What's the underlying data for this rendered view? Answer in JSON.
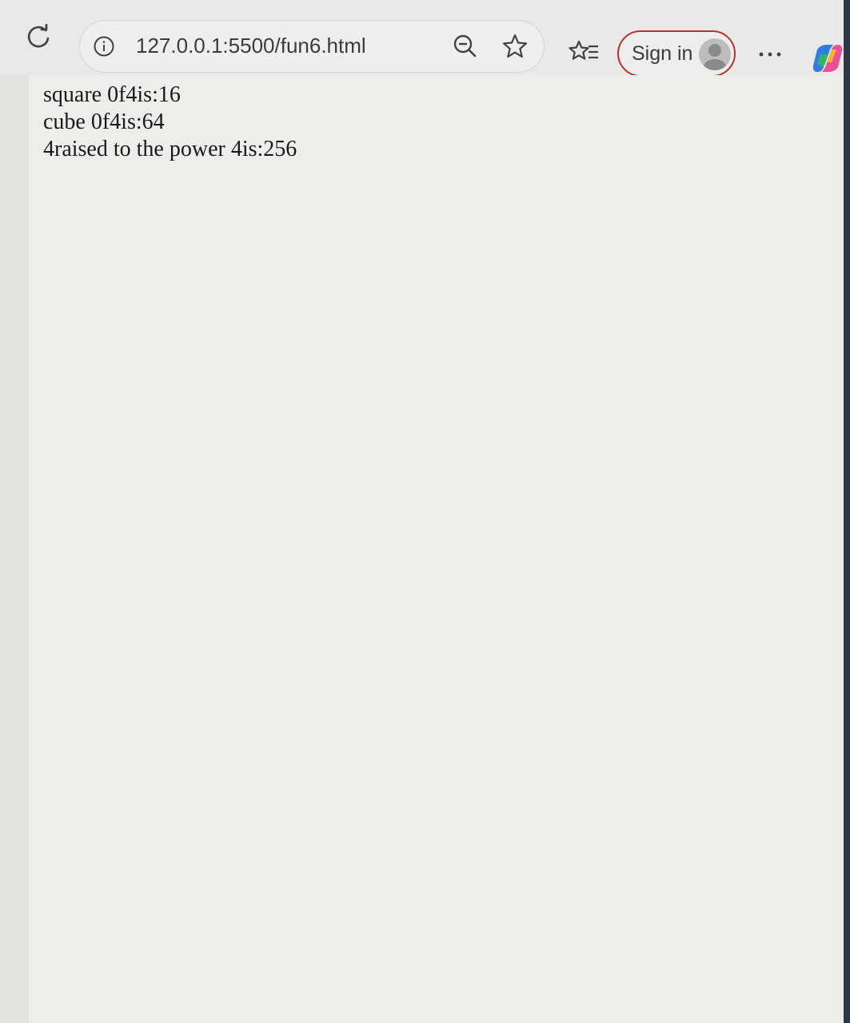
{
  "browser": {
    "url": "127.0.0.1:5500/fun6.html",
    "reload_icon": "reload-icon",
    "info_icon": "info-icon",
    "zoom_icon": "zoom-out-icon",
    "star_icon": "star-icon",
    "favorites_icon": "favorites-icon",
    "signin_label": "Sign in",
    "more_label": "...",
    "copilot_icon": "copilot-icon",
    "accent_color": "#b8312f"
  },
  "page": {
    "lines": [
      "square 0f4is:16",
      "cube 0f4is:64",
      "4raised to the power 4is:256"
    ]
  }
}
